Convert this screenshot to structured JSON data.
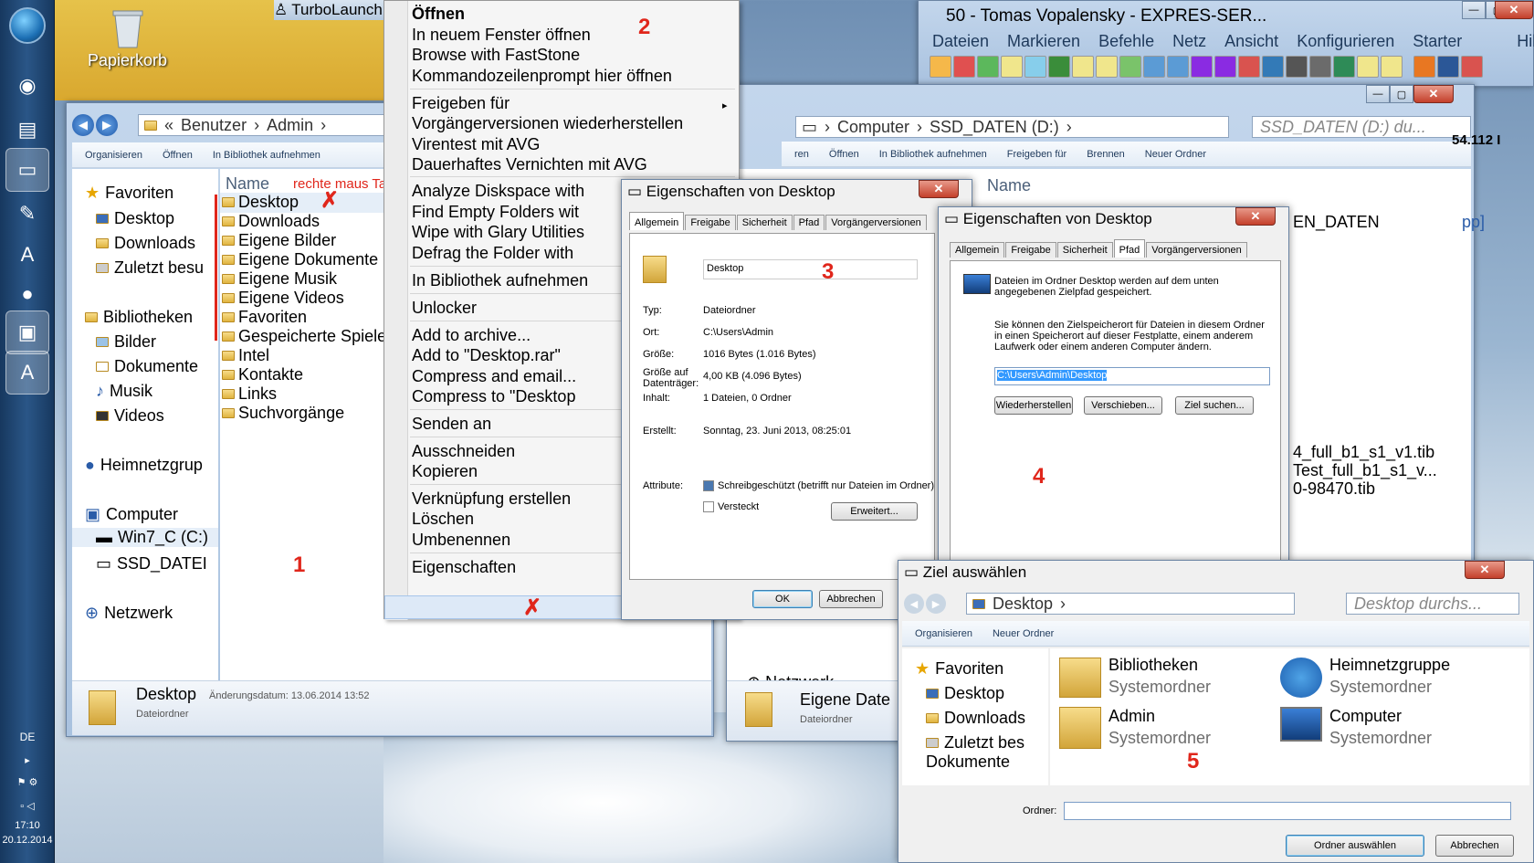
{
  "desktop": {
    "recycle_bin": "Papierkorb",
    "turbolaunch": "TurboLaunch"
  },
  "taskbar": {
    "lang": "DE",
    "time": "17:10",
    "date": "20.12.2014"
  },
  "explorer1": {
    "breadcrumb": [
      "Benutzer",
      "Admin"
    ],
    "cmd": [
      "Organisieren",
      "Öffnen",
      "In Bibliothek aufnehmen"
    ],
    "column_name": "Name",
    "annotation": "rechte maus Taste",
    "nav": {
      "favorites": "Favoriten",
      "fav_items": [
        "Desktop",
        "Downloads",
        "Zuletzt besu"
      ],
      "libraries": "Bibliotheken",
      "lib_items": [
        "Bilder",
        "Dokumente",
        "Musik",
        "Videos"
      ],
      "homegroup": "Heimnetzgrup",
      "computer": "Computer",
      "drives": [
        "Win7_C (C:)",
        "SSD_DATEI"
      ],
      "network": "Netzwerk"
    },
    "files": [
      "Desktop",
      "Downloads",
      "Eigene Bilder",
      "Eigene Dokumente",
      "Eigene Musik",
      "Eigene Videos",
      "Favoriten",
      "Gespeicherte Spiele",
      "Intel",
      "Kontakte",
      "Links",
      "Suchvorgänge"
    ],
    "detail_name": "Desktop",
    "detail_date": "Änderungsdatum: 13.06.2014 13:52",
    "detail_type": "Dateiordner",
    "marker": "1"
  },
  "context_menu": {
    "items": [
      "Öffnen",
      "In neuem Fenster öffnen",
      "Browse with FastStone",
      "Kommandozeilenprompt hier öffnen",
      "Freigeben für",
      "Vorgängerversionen wiederherstellen",
      "Virentest mit AVG",
      "Dauerhaftes Vernichten mit AVG",
      "Analyze Diskspace with",
      "Find Empty Folders wit",
      "Wipe with Glary Utilities",
      "Defrag the Folder with",
      "In Bibliothek aufnehmen",
      "Unlocker",
      "Add to archive...",
      "Add to \"Desktop.rar\"",
      "Compress and email...",
      "Compress to \"Desktop",
      "Senden an",
      "Ausschneiden",
      "Kopieren",
      "Verknüpfung erstellen",
      "Löschen",
      "Umbenennen",
      "Eigenschaften"
    ],
    "marker": "2"
  },
  "totalcmd": {
    "title": "50 - Tomas Vopalensky - EXPRES-SER...",
    "menu": [
      "Dateien",
      "Markieren",
      "Befehle",
      "Netz",
      "Ansicht",
      "Konfigurieren",
      "Starter",
      "Hilfe"
    ],
    "side_text": "54.112 I"
  },
  "explorer2": {
    "breadcrumb": [
      "Computer",
      "SSD_DATEN (D:)"
    ],
    "search": "SSD_DATEN (D:) du...",
    "cmd": [
      "ren",
      "Öffnen",
      "In Bibliothek aufnehmen",
      "Freigeben für",
      "Brennen",
      "Neuer Ordner"
    ],
    "column_name": "Name",
    "frag1": "EN_DATEN",
    "frag2": "pp]",
    "files": [
      "4_full_b1_s1_v1.tib",
      "Test_full_b1_s1_v...",
      "0-98470.tib"
    ],
    "network": "Netzwerk",
    "detail_name": "Eigene Date",
    "detail_type": "Dateiordner"
  },
  "props1": {
    "title": "Eigenschaften von Desktop",
    "tabs": [
      "Allgemein",
      "Freigabe",
      "Sicherheit",
      "Pfad",
      "Vorgängerversionen"
    ],
    "name": "Desktop",
    "rows": [
      {
        "k": "Typ:",
        "v": "Dateiordner"
      },
      {
        "k": "Ort:",
        "v": "C:\\Users\\Admin"
      },
      {
        "k": "Größe:",
        "v": "1016 Bytes (1.016 Bytes)"
      },
      {
        "k": "Größe auf Datenträger:",
        "v": "4,00 KB (4.096 Bytes)"
      },
      {
        "k": "Inhalt:",
        "v": "1 Dateien, 0 Ordner"
      },
      {
        "k": "Erstellt:",
        "v": "Sonntag, 23. Juni 2013, 08:25:01"
      }
    ],
    "attr_label": "Attribute:",
    "readonly": "Schreibgeschützt (betrifft nur Dateien im Ordner)",
    "hidden": "Versteckt",
    "advanced": "Erweitert...",
    "ok": "OK",
    "cancel": "Abbrechen",
    "marker": "3"
  },
  "props2": {
    "title": "Eigenschaften von Desktop",
    "tabs": [
      "Allgemein",
      "Freigabe",
      "Sicherheit",
      "Pfad",
      "Vorgängerversionen"
    ],
    "text1": "Dateien im Ordner Desktop werden auf dem unten angegebenen Zielpfad gespeichert.",
    "text2": "Sie können den Zielspeicherort für Dateien in diesem Ordner in einen Speicherort auf dieser Festplatte, einem anderem Laufwerk oder einem anderen Computer ändern.",
    "path": "C:\\Users\\Admin\\Desktop",
    "restore": "Wiederherstellen",
    "move": "Verschieben...",
    "find": "Ziel suchen...",
    "marker": "4"
  },
  "picker": {
    "title": "Ziel auswählen",
    "address": "Desktop",
    "search": "Desktop durchs...",
    "cmd": [
      "Organisieren",
      "Neuer Ordner"
    ],
    "nav": [
      "Favoriten",
      "Desktop",
      "Downloads",
      "Zuletzt bes",
      "Dokumente"
    ],
    "items": [
      {
        "name": "Bibliotheken",
        "type": "Systemordner"
      },
      {
        "name": "Heimnetzgruppe",
        "type": "Systemordner"
      },
      {
        "name": "Admin",
        "type": "Systemordner"
      },
      {
        "name": "Computer",
        "type": "Systemordner"
      }
    ],
    "folder_label": "Ordner:",
    "select": "Ordner auswählen",
    "cancel": "Abbrechen",
    "marker": "5"
  }
}
